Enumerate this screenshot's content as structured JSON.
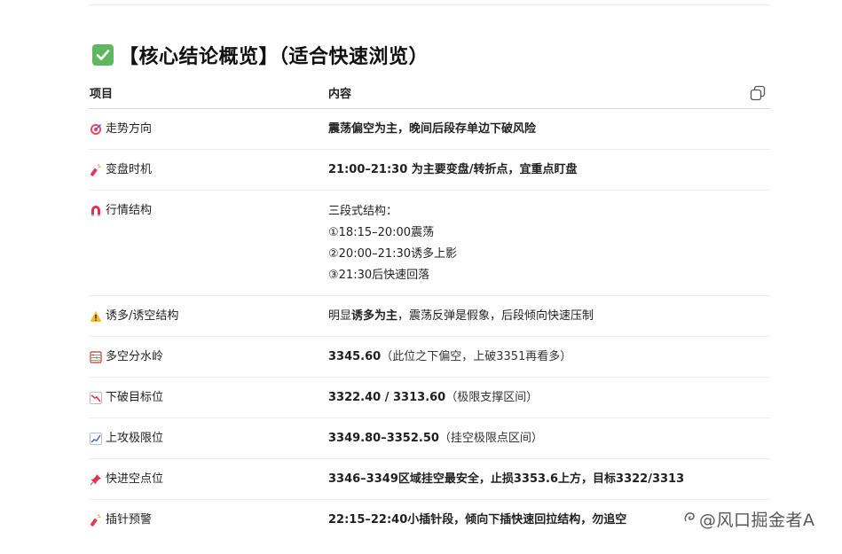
{
  "heading": {
    "text": "【核心结论概览】（适合快速浏览）"
  },
  "table": {
    "headers": [
      "项目",
      "内容"
    ],
    "rows": [
      {
        "icon": "target-icon",
        "label": "走势方向",
        "content": "震荡偏空为主，晚间后段存单边下破风险",
        "content_note": ""
      },
      {
        "icon": "firecracker-icon",
        "label": "变盘时机",
        "content": "21:00–21:30 为主要变盘/转折点，宜重点盯盘",
        "content_note": ""
      },
      {
        "icon": "magnet-icon",
        "label": "行情结构",
        "lines": [
          "三段式结构：",
          "①18:15–20:00震荡",
          "②20:00–21:30诱多上影",
          "③21:30后快速回落"
        ]
      },
      {
        "icon": "warning-icon",
        "label": "诱多/诱空结构",
        "content_parts": [
          "明显",
          "诱多为主",
          "，震荡反弹是假象，后段倾向快速压制"
        ]
      },
      {
        "icon": "abacus-icon",
        "label": "多空分水岭",
        "content": "3345.60",
        "content_note": "（此位之下偏空，上破3351再看多）"
      },
      {
        "icon": "chart-down-icon",
        "label": "下破目标位",
        "content": "3322.40 / 3313.60",
        "content_note": "（极限支撑区间）"
      },
      {
        "icon": "chart-up-icon",
        "label": "上攻极限位",
        "content": "3349.80–3352.50",
        "content_note": "（挂空极限点区间）"
      },
      {
        "icon": "pushpin-icon",
        "label": "快进空点位",
        "content": "3346–3349区域挂空最安全，止损3353.6上方，目标3322/3313",
        "content_note": ""
      },
      {
        "icon": "firecracker-icon",
        "label": "插针预警",
        "content": "22:15–22:40小插针段，倾向下插快速回拉结构，勿追空",
        "content_note": ""
      }
    ]
  },
  "watermark": {
    "text": "@风口掘金者A"
  }
}
